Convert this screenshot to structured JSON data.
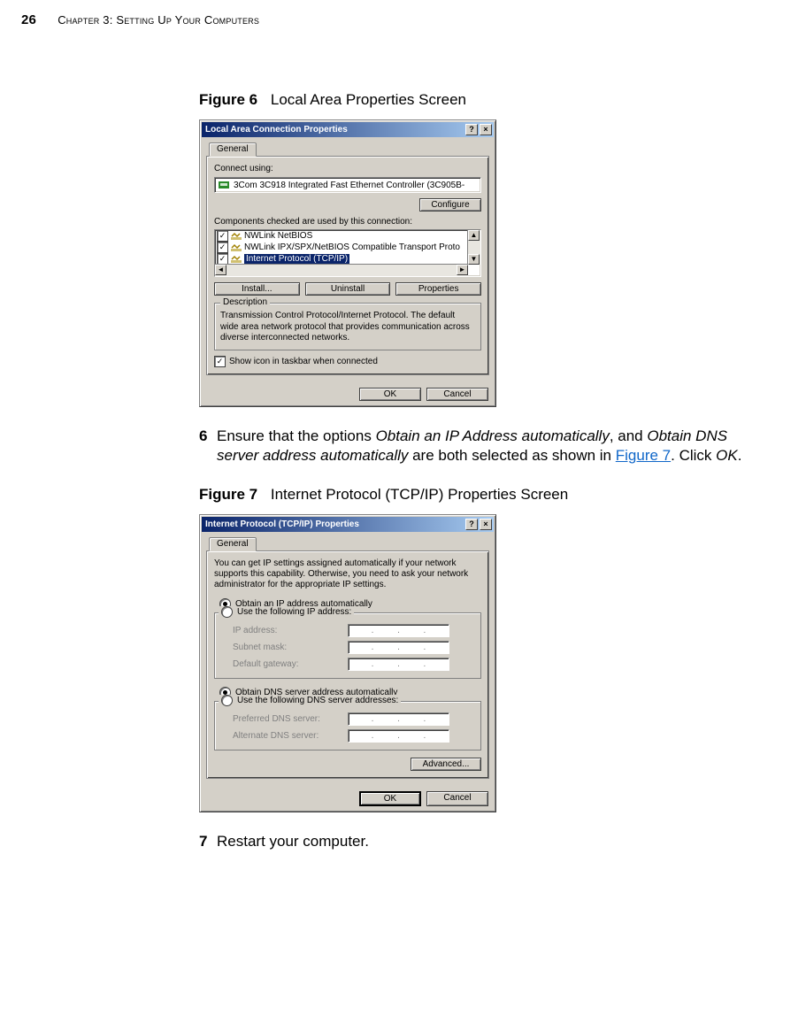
{
  "page": {
    "number": "26",
    "chapter": "Chapter 3: Setting Up Your Computers"
  },
  "figure6": {
    "label": "Figure 6",
    "title": "Local Area Properties Screen"
  },
  "step6": {
    "num": "6",
    "pre": "Ensure that the options ",
    "opt1": "Obtain an IP Address automatically",
    "mid1": ", and ",
    "opt2": "Obtain DNS server address automatically",
    "mid2": " are both selected as shown in ",
    "link": "Figure 7",
    "post": ". Click ",
    "ok": "OK",
    "end": "."
  },
  "figure7": {
    "label": "Figure 7",
    "title": "Internet Protocol (TCP/IP) Properties Screen"
  },
  "step7": {
    "num": "7",
    "text": "Restart your computer."
  },
  "dlgA": {
    "title": "Local Area Connection Properties",
    "tab": "General",
    "connect_using_label": "Connect using:",
    "adapter": "3Com 3C918 Integrated Fast Ethernet Controller (3C905B-",
    "configure": "Configure",
    "components_label": "Components checked are used by this connection:",
    "items": [
      "NWLink NetBIOS",
      "NWLink IPX/SPX/NetBIOS Compatible Transport Proto",
      "Internet Protocol (TCP/IP)"
    ],
    "install": "Install...",
    "uninstall": "Uninstall",
    "properties": "Properties",
    "desc_label": "Description",
    "desc_text": "Transmission Control Protocol/Internet Protocol. The default wide area network protocol that provides communication across diverse interconnected networks.",
    "showicon": "Show icon in taskbar when connected",
    "ok": "OK",
    "cancel": "Cancel"
  },
  "dlgB": {
    "title": "Internet Protocol (TCP/IP) Properties",
    "tab": "General",
    "info": "You can get IP settings assigned automatically if your network supports this capability. Otherwise, you need to ask your network administrator for the appropriate IP settings.",
    "r1": "Obtain an IP address automatically",
    "r2": "Use the following IP address:",
    "ip_label": "IP address:",
    "subnet_label": "Subnet mask:",
    "gateway_label": "Default gateway:",
    "r3": "Obtain DNS server address automatically",
    "r4": "Use the following DNS server addresses:",
    "pref_dns": "Preferred DNS server:",
    "alt_dns": "Alternate DNS server:",
    "advanced": "Advanced...",
    "ok": "OK",
    "cancel": "Cancel"
  }
}
